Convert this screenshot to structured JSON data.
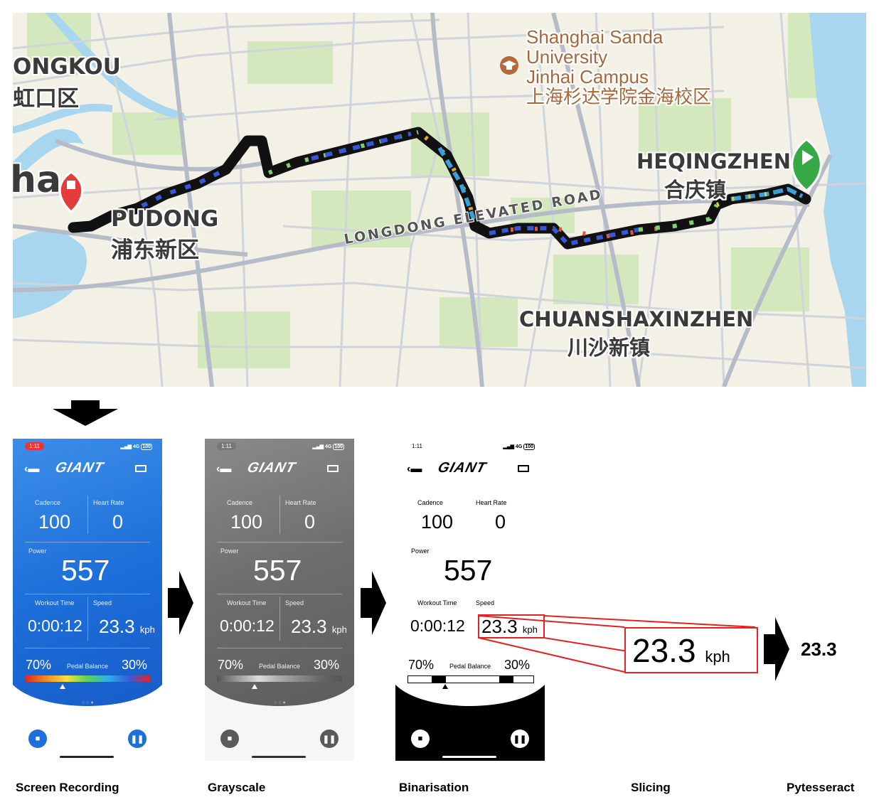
{
  "map": {
    "colors": {
      "land": "#f3f1e6",
      "green": "#d3e8bd",
      "water": "#a8d6ee",
      "road": "#cfd3da",
      "road_major": "#b5bcc8",
      "route_outline": "#111111",
      "end_pin": "#e63b3b",
      "start_pin": "#36a845"
    },
    "labels": {
      "hongkou_en": "ONGKOU",
      "hongkou_zh": "虹口区",
      "shanghai_partial": "ha",
      "pudong_en": "PUDONG",
      "pudong_zh": "浦东新区",
      "university_l1": "Shanghai Sanda",
      "university_l2": "University",
      "university_l3": "Jinhai Campus",
      "university_zh": "上海杉达学院金海校区",
      "heqingzhen_en": "HEQINGZHEN",
      "heqingzhen_zh": "合庆镇",
      "road": "LONGDONG ELEVATED ROAD",
      "chuansha_en": "CHUANSHAXINZHEN",
      "chuansha_zh": "川沙新镇"
    },
    "icons": {
      "end": "stop-pin-icon",
      "start": "play-pin-icon",
      "campus": "graduation-cap-icon"
    }
  },
  "phones": [
    {
      "theme": "color",
      "time": "1:11",
      "status": "4G",
      "battery": "100",
      "logo": "GIANT",
      "cadence_label": "Cadence",
      "cadence": "100",
      "heart_label": "Heart Rate",
      "heart": "0",
      "power_label": "Power",
      "power": "557",
      "workout_label": "Workout Time",
      "workout": "0:00:12",
      "speed_label": "Speed",
      "speed": "23.3",
      "speed_unit": "kph",
      "left_pct": "70%",
      "balance_label": "Pedal Balance",
      "right_pct": "30%"
    },
    {
      "theme": "gray",
      "time": "1:11",
      "status": "4G",
      "battery": "100",
      "logo": "GIANT",
      "cadence_label": "Cadence",
      "cadence": "100",
      "heart_label": "Heart Rate",
      "heart": "0",
      "power_label": "Power",
      "power": "557",
      "workout_label": "Workout Time",
      "workout": "0:00:12",
      "speed_label": "Speed",
      "speed": "23.3",
      "speed_unit": "kph",
      "left_pct": "70%",
      "balance_label": "Pedal Balance",
      "right_pct": "30%"
    },
    {
      "theme": "binary",
      "time": "1:11",
      "status": "4G",
      "battery": "100",
      "logo": "GIANT",
      "cadence_label": "Cadence",
      "cadence": "100",
      "heart_label": "Heart Rate",
      "heart": "0",
      "power_label": "Power",
      "power": "557",
      "workout_label": "Workout Time",
      "workout": "0:00:12",
      "speed_label": "Speed",
      "speed": "23.3",
      "speed_unit": "kph",
      "left_pct": "70%",
      "balance_label": "Pedal Balance",
      "right_pct": "30%"
    }
  ],
  "slice": {
    "value": "23.3",
    "unit": "kph",
    "color": "#e22222"
  },
  "ocr_result": "23.3",
  "captions": {
    "screen_recording": "Screen Recording",
    "grayscale": "Grayscale",
    "binarisation": "Binarisation",
    "slicing": "Slicing",
    "pytesseract": "Pytesseract"
  }
}
